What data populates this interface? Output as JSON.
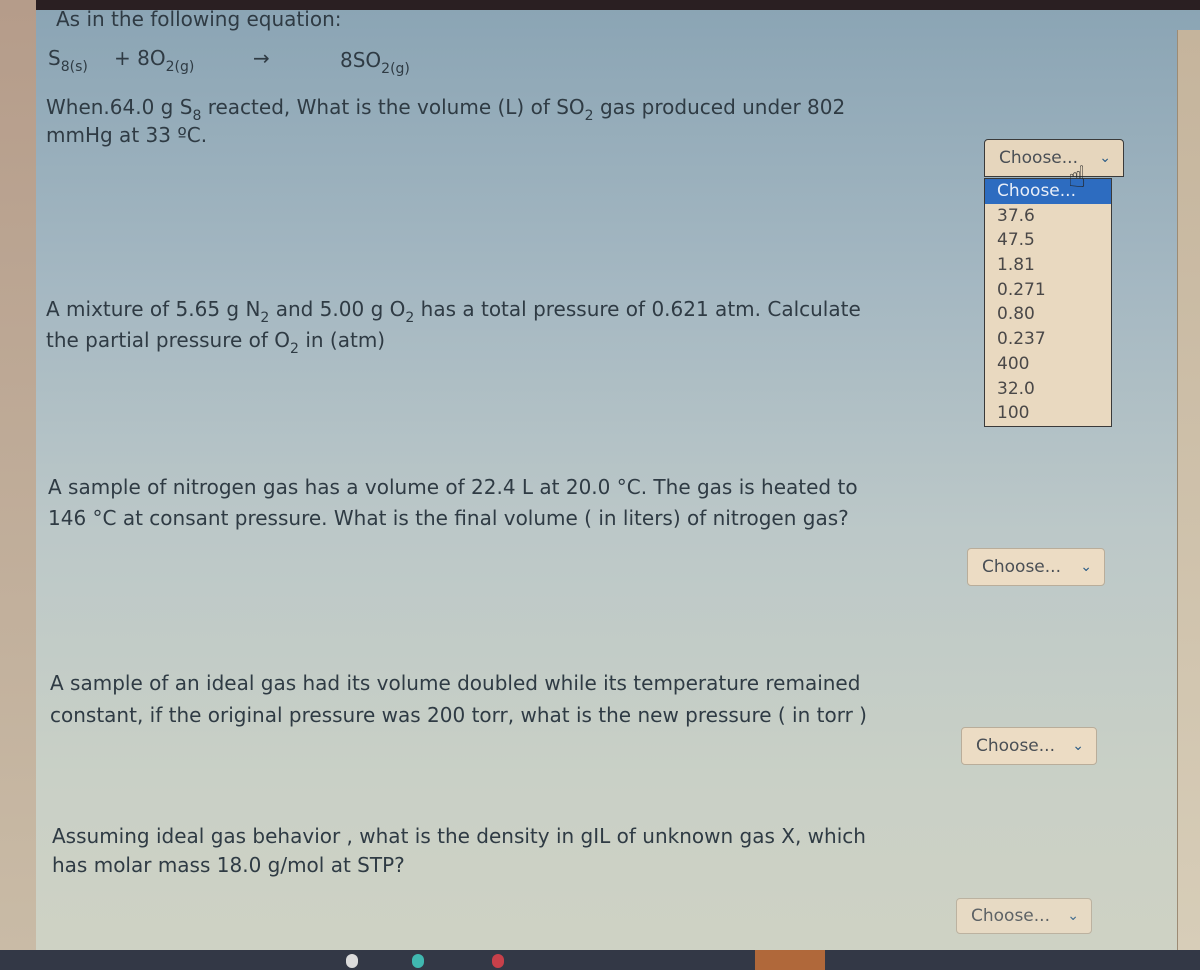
{
  "questions": [
    {
      "intro": "As in the following equation:",
      "equation": {
        "reactant1": "S",
        "reactant1_sub": "8(s)",
        "plus": "+ 8O",
        "reactant2_sub": "2(g)",
        "arrow": "→",
        "product": "8SO",
        "product_sub": "2(g)"
      },
      "line1_a": "When.64.0 g S",
      "line1_sub1": "8",
      "line1_b": " reacted, What is the volume (L) of SO",
      "line1_sub2": "2",
      "line1_c": " gas produced under 802",
      "line2": "mmHg at 33 ºC.",
      "select": {
        "value": "Choose...",
        "open": true,
        "options": [
          "Choose...",
          "37.6",
          "47.5",
          "1.81",
          "0.271",
          "0.80",
          "0.237",
          "400",
          "32.0",
          "100"
        ],
        "highlighted": "Choose..."
      }
    },
    {
      "line1_a": "A mixture of 5.65 g N",
      "line1_sub1": "2",
      "line1_b": " and 5.00 g O",
      "line1_sub2": "2",
      "line1_c": " has a total pressure of 0.621 atm. Calculate",
      "line2_a": "the partial pressure of O",
      "line2_sub": "2",
      "line2_b": " in (atm)"
    },
    {
      "line1": "A sample of nitrogen gas has a volume of 22.4 L at 20.0 °C. The gas is heated to",
      "line2": "146 °C at consant pressure. What is the final volume ( in liters) of nitrogen gas?",
      "select": {
        "value": "Choose..."
      }
    },
    {
      "line1": "A sample of an ideal gas had its volume doubled while its temperature remained",
      "line2": "constant, if the original pressure was 200 torr, what is the new pressure ( in torr )",
      "select": {
        "value": "Choose..."
      }
    },
    {
      "line1": "Assuming ideal gas behavior , what is the density in gIL of unknown gas X, which",
      "line2": "has molar mass 18.0 g/mol at STP?",
      "select": {
        "value": "Choose..."
      }
    }
  ],
  "icons": {
    "chevron": "⌄",
    "cursor": "☝"
  },
  "colors": {
    "highlight": "#2d6cc0",
    "select_bg": "#ecdcc4",
    "text": "#2f3b44"
  }
}
